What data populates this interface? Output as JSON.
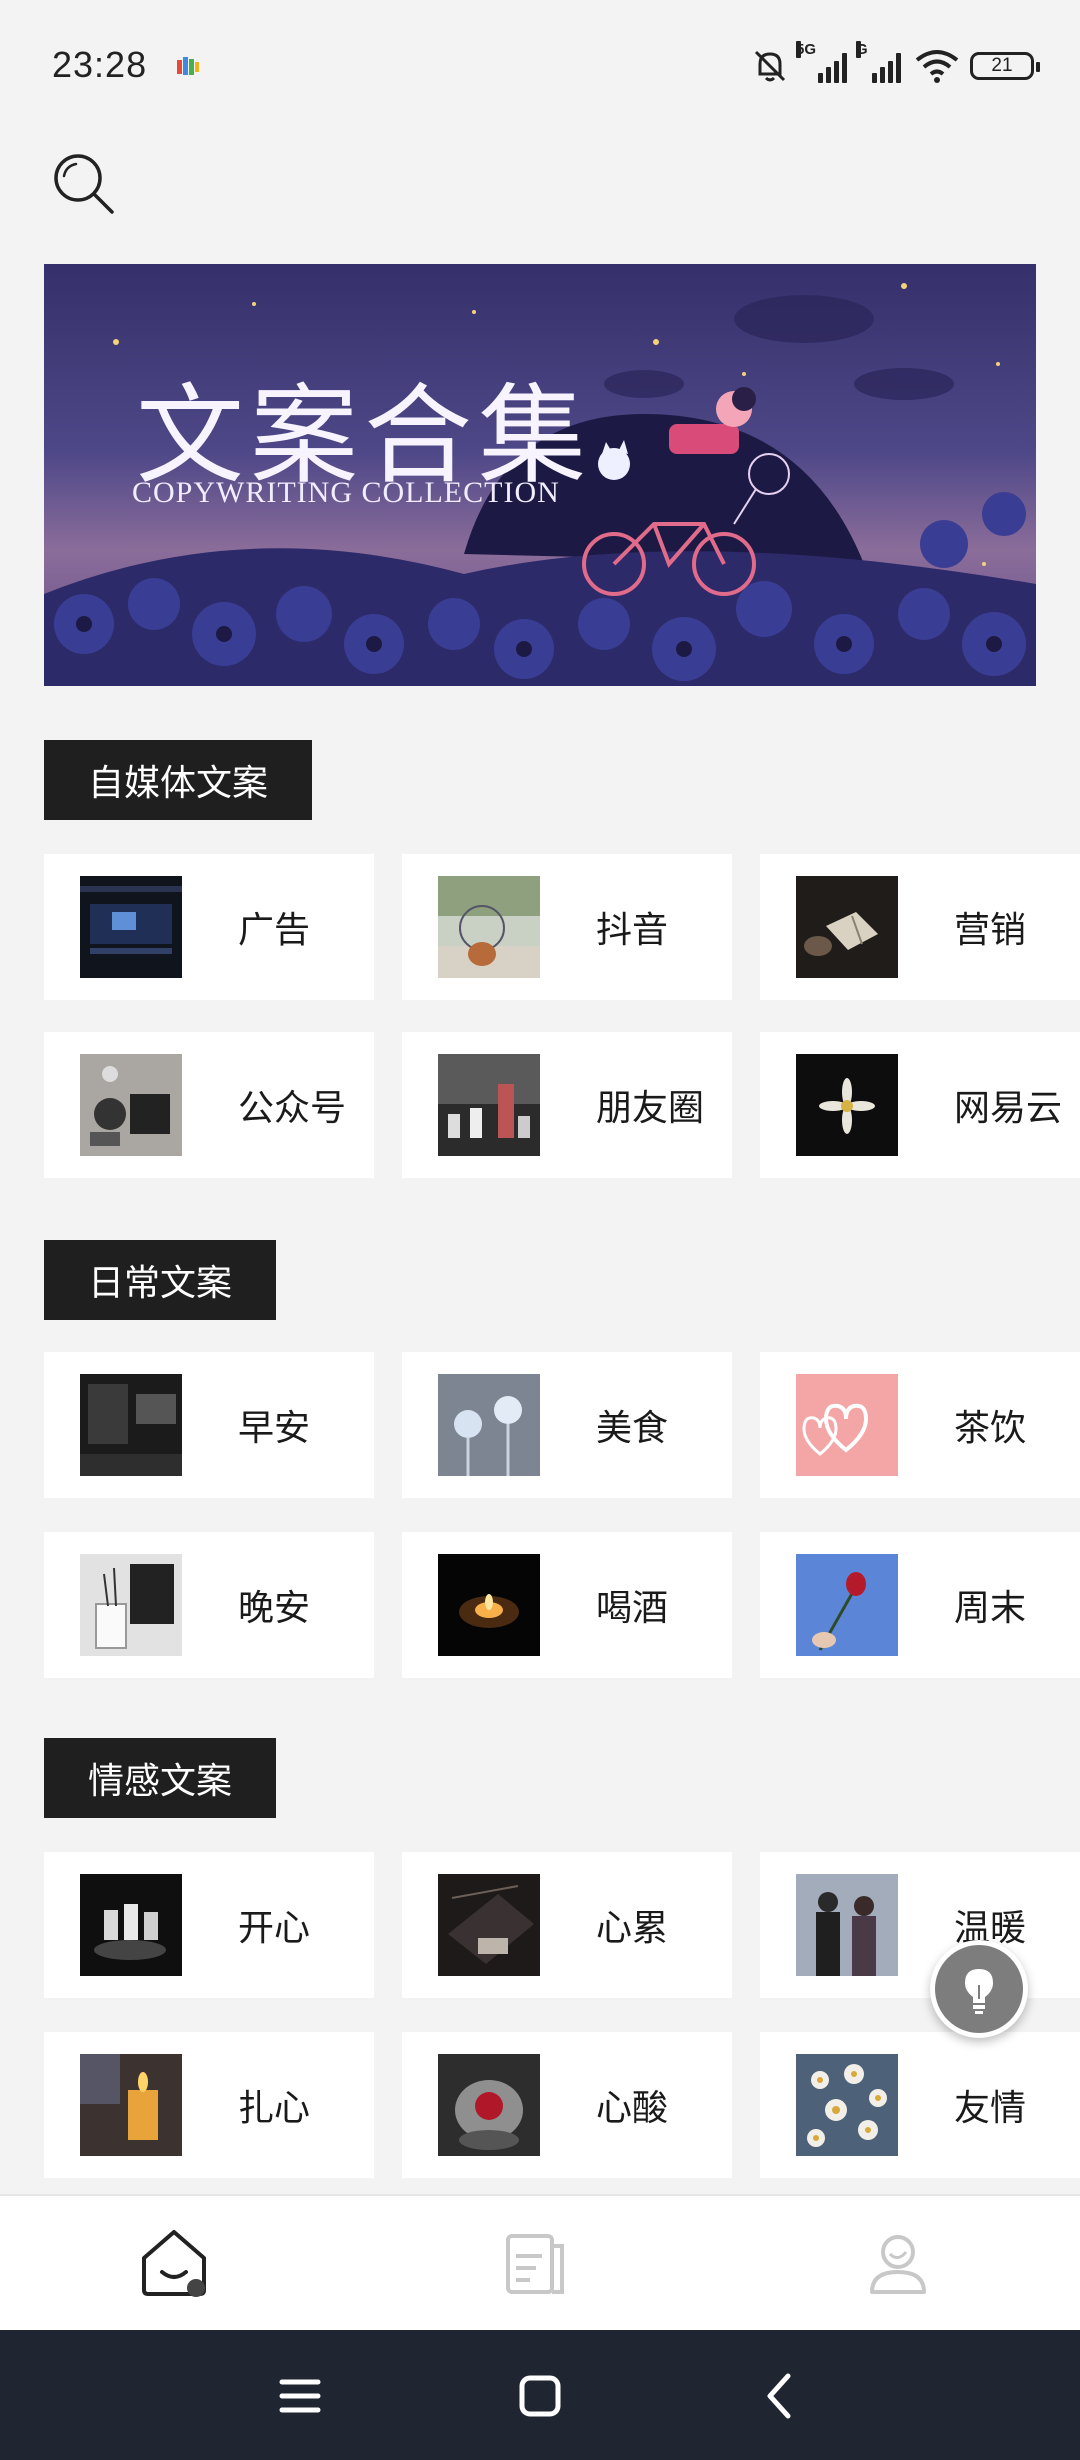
{
  "status_bar": {
    "time": "23:28",
    "network_1": "5G",
    "network_2": "G",
    "battery": "21"
  },
  "banner": {
    "title": "文案合集",
    "subtitle": "COPYWRITING COLLECTION"
  },
  "sections": [
    {
      "title": "自媒体文案",
      "items": [
        "广告",
        "抖音",
        "营销",
        "公众号",
        "朋友圈",
        "网易云"
      ]
    },
    {
      "title": "日常文案",
      "items": [
        "早安",
        "美食",
        "茶饮",
        "晚安",
        "喝酒",
        "周末"
      ]
    },
    {
      "title": "情感文案",
      "items": [
        "开心",
        "心累",
        "温暖",
        "扎心",
        "心酸",
        "友情"
      ]
    }
  ],
  "icons": {
    "search": "search-icon",
    "fab": "lightbulb-icon",
    "nav": [
      "home-icon",
      "document-icon",
      "profile-icon"
    ],
    "system": [
      "menu-icon",
      "home-square-icon",
      "back-icon"
    ]
  },
  "colors": {
    "section_bg": "#1f1f1f",
    "page_bg": "#f3f3f3",
    "system_nav": "#1f2632"
  }
}
